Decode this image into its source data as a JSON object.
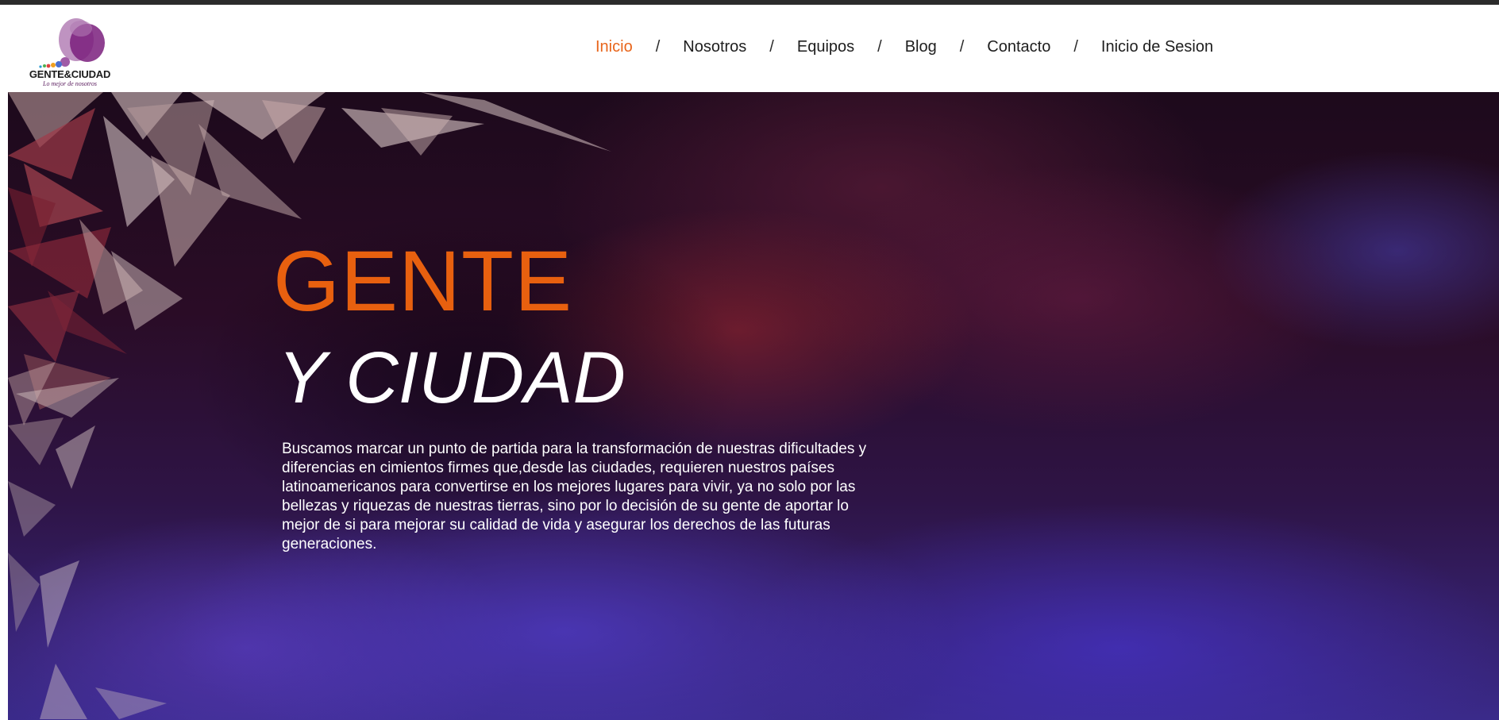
{
  "brand": {
    "logo_name": "GENTE&CIUDAD",
    "logo_tagline": "Lo mejor de nosotros"
  },
  "nav": {
    "items": [
      {
        "label": "Inicio",
        "active": true
      },
      {
        "label": "Nosotros",
        "active": false
      },
      {
        "label": "Equipos",
        "active": false
      },
      {
        "label": "Blog",
        "active": false
      },
      {
        "label": "Contacto",
        "active": false
      },
      {
        "label": "Inicio de Sesion",
        "active": false
      }
    ],
    "separator": "/"
  },
  "hero": {
    "title_line1": "GENTE",
    "title_line2": "Y CIUDAD",
    "description": "Buscamos marcar un punto de partida para la transformación de nuestras dificultades y diferencias en cimientos firmes que,desde las ciudades, requieren nuestros países latinoamericanos para convertirse en los mejores lugares para vivir, ya no solo por las bellezas y riquezas de nuestras tierras, sino por lo decisión de su gente de aportar lo mejor de si para mejorar su calidad de vida y asegurar los derechos de las futuras generaciones."
  },
  "colors": {
    "accent": "#e8651b",
    "nav_text": "#1e1e1e",
    "hero_title_white": "#ffffff",
    "logo_purple": "#7a2a7e"
  }
}
